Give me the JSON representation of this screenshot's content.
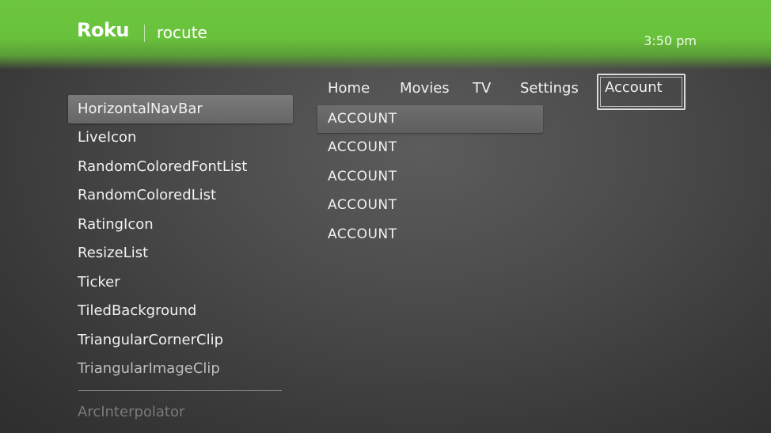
{
  "header": {
    "logo_text": "Roku",
    "app_name": "rocute",
    "clock": "3:50 pm"
  },
  "left_list": {
    "items": [
      {
        "label": "HorizontalNavBar"
      },
      {
        "label": "LiveIcon"
      },
      {
        "label": "RandomColoredFontList"
      },
      {
        "label": "RandomColoredList"
      },
      {
        "label": "RatingIcon"
      },
      {
        "label": "ResizeList"
      },
      {
        "label": "Ticker"
      },
      {
        "label": "TiledBackground"
      },
      {
        "label": "TriangularCornerClip"
      },
      {
        "label": "TriangularImageClip"
      },
      {
        "label": "ArcInterpolator"
      }
    ],
    "focused_index": 0
  },
  "nav": {
    "tabs": [
      {
        "label": "Home"
      },
      {
        "label": "Movies"
      },
      {
        "label": "TV"
      },
      {
        "label": "Settings"
      },
      {
        "label": "Account"
      }
    ],
    "selected_index": 4
  },
  "content_list": {
    "items": [
      {
        "label": "ACCOUNT"
      },
      {
        "label": "ACCOUNT"
      },
      {
        "label": "ACCOUNT"
      },
      {
        "label": "ACCOUNT"
      },
      {
        "label": "ACCOUNT"
      }
    ],
    "focused_index": 0
  }
}
